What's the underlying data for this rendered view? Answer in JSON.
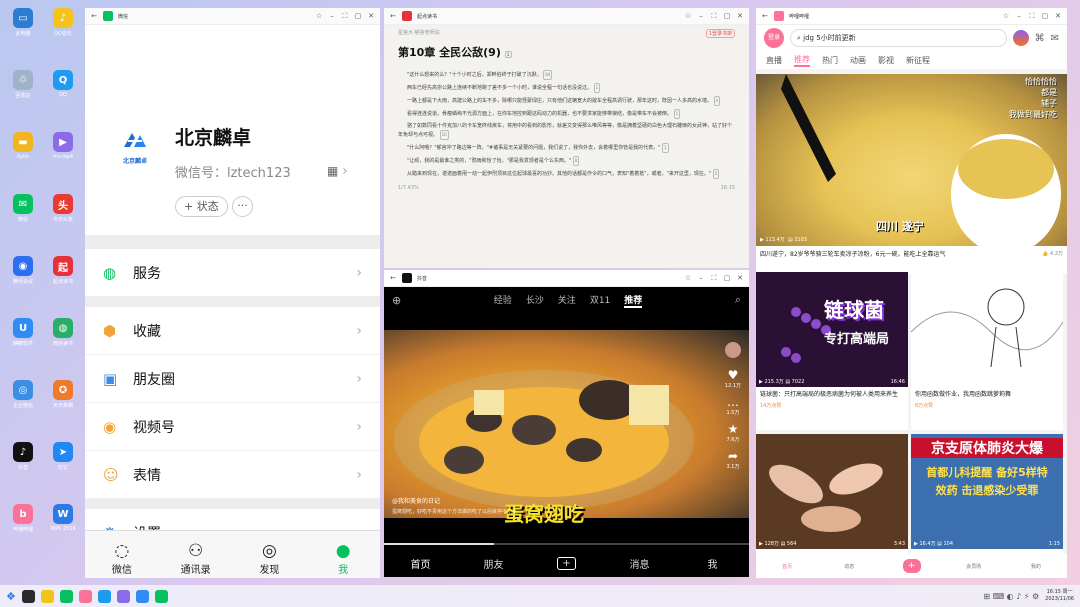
{
  "desktop": {
    "icons": [
      {
        "label": "此电脑",
        "color": "#2b7cd3",
        "glyph": "▭",
        "icon": "computer-icon"
      },
      {
        "label": "QQ音乐",
        "color": "#f6c21c",
        "glyph": "♪",
        "icon": "qq-music-icon"
      },
      {
        "label": "回收站",
        "color": "#9fb3c8",
        "glyph": "♲",
        "icon": "recycle-bin-icon"
      },
      {
        "label": "QQ",
        "color": "#1e9af0",
        "glyph": "Q",
        "icon": "qq-icon"
      },
      {
        "label": "Kylin",
        "color": "#f2b51d",
        "glyph": "▬",
        "icon": "folder-icon"
      },
      {
        "label": "mv.mp4",
        "color": "#8c6be8",
        "glyph": "▶",
        "icon": "video-file-icon"
      },
      {
        "label": "微信",
        "color": "#07c160",
        "glyph": "✉",
        "icon": "wechat-icon"
      },
      {
        "label": "今日头条",
        "color": "#e83b32",
        "glyph": "头",
        "icon": "toutiao-icon"
      },
      {
        "label": "腾讯会议",
        "color": "#2c6ef2",
        "glyph": "◉",
        "icon": "tencent-meeting-icon"
      },
      {
        "label": "起点读书",
        "color": "#e8303a",
        "glyph": "起",
        "icon": "qidian-icon"
      },
      {
        "label": "麒麟软件",
        "color": "#2f8cf4",
        "glyph": "U",
        "icon": "kylin-store-icon"
      },
      {
        "label": "微信读书",
        "color": "#2aae67",
        "glyph": "◍",
        "icon": "wechat-read-icon"
      },
      {
        "label": "企业微信",
        "color": "#3a8ee6",
        "glyph": "◎",
        "icon": "wecom-icon"
      },
      {
        "label": "天天象棋",
        "color": "#f07a2b",
        "glyph": "✪",
        "icon": "chess-icon"
      },
      {
        "label": "抖音",
        "color": "#111111",
        "glyph": "♪",
        "icon": "douyin-icon"
      },
      {
        "label": "钉钉",
        "color": "#1f88f2",
        "glyph": "➤",
        "icon": "dingtalk-icon"
      },
      {
        "label": "哔哩哔哩",
        "color": "#fb7299",
        "glyph": "b",
        "icon": "bilibili-icon"
      },
      {
        "label": "WPS 2019",
        "color": "#2b7be6",
        "glyph": "W",
        "icon": "wps-icon"
      }
    ]
  },
  "wechat": {
    "title": "微信",
    "profile_name": "北京麟卓",
    "logo_text": "北京麟卓",
    "wechat_id": "微信号：lztech123",
    "status_label": "+ 状态",
    "more_label": "···",
    "menu": [
      {
        "label": "服务",
        "icon": "service-icon",
        "glyph": "◍",
        "color": "#07c160"
      },
      {
        "label": "收藏",
        "icon": "favorites-icon",
        "glyph": "⬢",
        "color": "#f2a33a"
      },
      {
        "label": "朋友圈",
        "icon": "moments-icon",
        "glyph": "▣",
        "color": "#3c8ce6"
      },
      {
        "label": "视频号",
        "icon": "channels-icon",
        "glyph": "◉",
        "color": "#f2a33a"
      },
      {
        "label": "表情",
        "icon": "sticker-icon",
        "glyph": "☺",
        "color": "#f2a33a"
      },
      {
        "label": "设置",
        "icon": "settings-icon",
        "glyph": "⚙",
        "color": "#3c8ce6"
      }
    ],
    "tabs": [
      {
        "label": "微信",
        "glyph": "◌",
        "icon": "chat-tab-icon"
      },
      {
        "label": "通讯录",
        "glyph": "⚇",
        "icon": "contacts-tab-icon"
      },
      {
        "label": "发现",
        "glyph": "◎",
        "icon": "discover-tab-icon"
      },
      {
        "label": "我",
        "glyph": "●",
        "icon": "me-tab-icon"
      }
    ]
  },
  "reader": {
    "title": "起点读书",
    "badge": "1登录书架",
    "header_small": "星宫大·郁宫老师说",
    "chapter": "第10章 全民公敌(9)",
    "chapter_badge": "1",
    "paragraphs": [
      {
        "text": "\"这什么想来的么？\"十个小时之后，郑畔伯终于打破了沉默。",
        "badge": "84"
      },
      {
        "text": "两车已经先高崇公路上连续不断地跑了差不多一个小时，谁说全程一句话也没说过。",
        "badge": "1"
      },
      {
        "text": "一路上都是下大雨，高建公路上的车不多，除哪只能怪蒙绿庄，只有他们这辆宽大的敞车全程高调行驶，那年这时，既因一人多高的水墙。",
        "badge": "4"
      },
      {
        "text": "看得连连说道，骨瘦嶙峋不光源方面上，在你车地控到跟这码动力的机器，也不要求家能够带狼结，像是带车不会被倒。",
        "badge": "1"
      },
      {
        "text": "骆了如数同看十件克加八的卡车宽终线疾车，将用中的看到的影形，就差文变得那么唯风等等，像是拥着坚硬的白色大理石雕琢的女武神，站了好个年免却与点可视。",
        "badge": "10"
      },
      {
        "text": "\"什么阿哦？\"郁宫冲了路边等一阵，\"#诸事是无关紧要的问题，我们说了，我你外去，会着哪里你管是我的代表。\"",
        "badge": "1"
      },
      {
        "text": "\"让顽，我的是最谁之类的，\"鸦雨和怡了怡，\"那是我发现者是个么东西。\"",
        "badge": "8"
      },
      {
        "text": "从踏来到现在，诺诺面着甩一动一起伊刑顶目这位起球最喜的功抄。其他的话都是作令的口气，表知\"着着抵\"，或者，\"来开这里，现在。\"",
        "badge": "5"
      }
    ],
    "progress_left": "1/7.43%",
    "progress_right": "16:15"
  },
  "douyin": {
    "title": "抖音",
    "tabs": [
      "经验",
      "长沙",
      "关注",
      "双11",
      "推荐"
    ],
    "active_tab": "推荐",
    "caption_big": "蛋窝翅吃",
    "author": "@我和美食的日记",
    "caption_small": "蛋窝翅吃，好吃不贵用这个方法做的吃了以后就停不下来",
    "side_counts": [
      "12.1万",
      "1.5万",
      "7.6万",
      "3.1万"
    ],
    "bottom_tabs": [
      "首页",
      "朋友",
      "+",
      "消息",
      "我"
    ]
  },
  "bilibili": {
    "title": "哔哩哔哩",
    "login_label": "登录",
    "search_text": "jdg 5小时前更新",
    "tabs": [
      "直播",
      "推荐",
      "热门",
      "动画",
      "影视",
      "新征程"
    ],
    "active_tab": "推荐",
    "hero": {
      "overlay_lines": [
        "恰恰恰恰",
        "都是",
        "辅子",
        "我做到最好吃"
      ],
      "location": "四川 遂宁",
      "views": "113.4万",
      "danmaku": "3103",
      "title": "四川遂宁，82岁爷爷骑三轮车卖凉子凉粉，6元一碗，能吃上全靠运气",
      "likes": "4.2万"
    },
    "cards": [
      {
        "thumb_text": "链球菌",
        "thumb_sub": "专打高端局",
        "views": "215.3万",
        "danmaku": "7022",
        "duration": "16:46",
        "title": "链球菌：只打高端局的极恶病菌为何被人类用来养生",
        "tag": "14万点赞"
      },
      {
        "thumb_text": "",
        "thumb_sub": "",
        "views": "81.1万",
        "danmaku": "260",
        "duration": "0:50",
        "title": "你用函数做作业，我用函数跳萝莉舞",
        "tag": "8万点赞"
      },
      {
        "thumb_text": "",
        "thumb_sub": "",
        "views": "128万",
        "danmaku": "564",
        "duration": "3:43",
        "title": "",
        "tag": ""
      },
      {
        "thumb_text": "京支原体肺炎大爆",
        "thumb_sub": "首都儿科提醒 备好5样特效药 击退感染少受罪",
        "views": "16.4万",
        "danmaku": "104",
        "duration": "1:15",
        "title": "",
        "tag": ""
      }
    ],
    "bottom_tabs": [
      "首页",
      "动态",
      "+",
      "会员购",
      "我的"
    ]
  },
  "taskbar": {
    "icons": [
      "#2b2b2b",
      "#f0c419",
      "#07c160",
      "#fb7299",
      "#1e9af0",
      "#8c6be8",
      "#2f8cf4",
      "#07c160"
    ],
    "clock": "16:15 周一",
    "date": "2023/11/06"
  }
}
